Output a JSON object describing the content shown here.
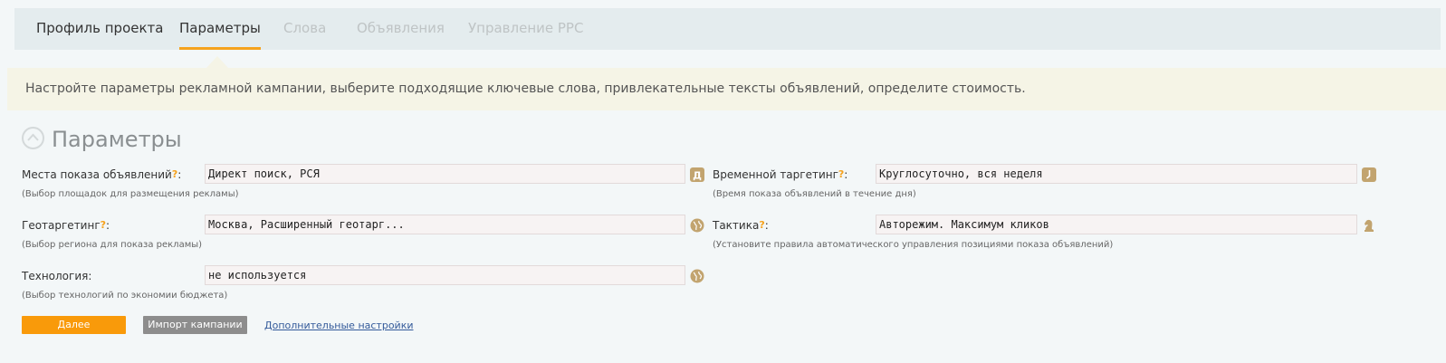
{
  "tabs": [
    {
      "label": "Профиль проекта"
    },
    {
      "label": "Параметры"
    },
    {
      "label": "Слова"
    },
    {
      "label": "Объявления"
    },
    {
      "label": "Управление PPC"
    }
  ],
  "notice": "Настройте параметры рекламной кампании, выберите подходящие ключевые слова, привлекательные тексты объявлений, определите стоимость.",
  "section": {
    "title": "Параметры"
  },
  "fields": {
    "placements": {
      "label": "Места показа объявлений",
      "help": "?",
      "hint": "(Выбор площадок для размещения рекламы)",
      "value": "Директ поиск, РСЯ",
      "icon": "letter-d-icon"
    },
    "time_targeting": {
      "label": "Временной таргетинг",
      "help": "?",
      "hint": "(Время показа объявлений в течение дня)",
      "value": "Круглосуточно, вся неделя",
      "icon": "clock-icon"
    },
    "geo_targeting": {
      "label": "Геотаргетинг",
      "help": "?",
      "hint": "(Выбор региона для показа рекламы)",
      "value": "Москва, Расширенный геотарг...",
      "icon": "globe-icon"
    },
    "tactic": {
      "label": "Тактика",
      "help": "?",
      "hint": "(Установите правила автоматического управления позициями показа объявлений)",
      "value": "Авторежим. Максимум кликов",
      "icon": "chess-knight-icon"
    },
    "technology": {
      "label": "Технология",
      "hint": "(Выбор технологий по экономии бюджета)",
      "value": "не используется",
      "icon": "globe-icon"
    }
  },
  "buttons": {
    "next": "Далее",
    "import": "Импорт кампании",
    "advanced": "Дополнительные настройки"
  },
  "colors": {
    "accent": "#f5a21d",
    "primary_button": "#f99a0a",
    "secondary_button": "#8d8d8d",
    "icon": "#c2a46f",
    "link": "#335a9a"
  }
}
